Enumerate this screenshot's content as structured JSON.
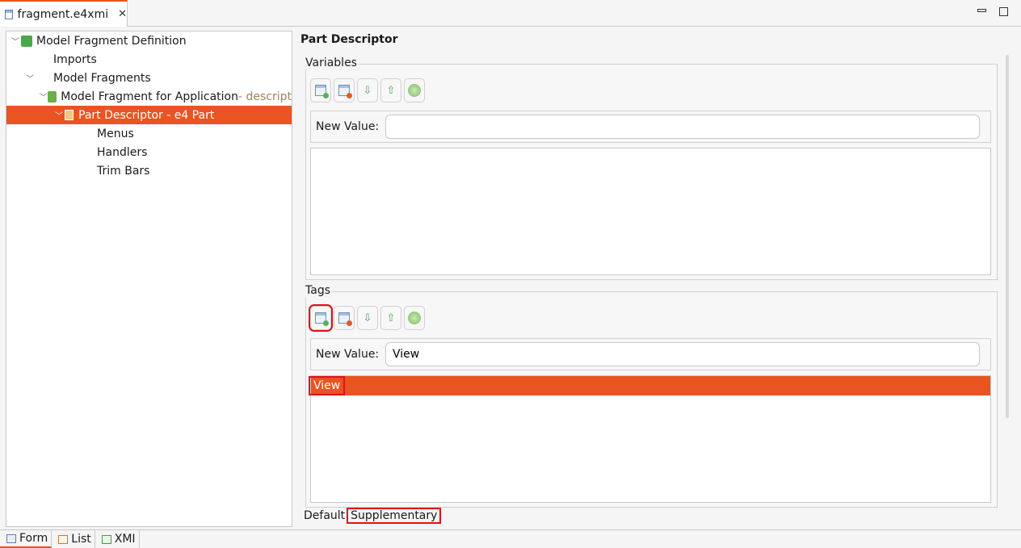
{
  "editor": {
    "tab_title": "fragment.e4xmi",
    "close_icon": "close-icon",
    "minimize_icon": "minimize-icon",
    "maximize_icon": "maximize-icon"
  },
  "tree": {
    "items": [
      {
        "label": "Model Fragment Definition",
        "suffix": "",
        "icon": "puzzle-icon",
        "expanded": true
      },
      {
        "label": "Imports",
        "suffix": ""
      },
      {
        "label": "Model Fragments",
        "suffix": "",
        "expanded": true
      },
      {
        "label": "Model Fragment for Application",
        "suffix": " - descript",
        "icon": "puzzle-edit-icon",
        "expanded": true
      },
      {
        "label": "Part Descriptor - e4 Part",
        "suffix": "",
        "icon": "part-descriptor-icon",
        "expanded": true,
        "selected": true
      },
      {
        "label": "Menus",
        "suffix": ""
      },
      {
        "label": "Handlers",
        "suffix": ""
      },
      {
        "label": "Trim Bars",
        "suffix": ""
      }
    ]
  },
  "detail": {
    "title": "Part Descriptor",
    "variables": {
      "label": "Variables",
      "new_value_label": "New Value:",
      "new_value": ""
    },
    "tags": {
      "label": "Tags",
      "new_value_label": "New Value:",
      "new_value": "View",
      "items": [
        "View"
      ]
    },
    "toolbar_icons": [
      "add-icon",
      "remove-icon",
      "move-down-icon",
      "move-up-icon",
      "edit-icon"
    ],
    "bottom_tabs": [
      "Default",
      "Supplementary"
    ],
    "active_bottom_tab": "Supplementary"
  },
  "page_tabs": [
    {
      "label": "Form",
      "icon": "form-icon",
      "active": true
    },
    {
      "label": "List",
      "icon": "list-icon"
    },
    {
      "label": "XMI",
      "icon": "xmi-tree-icon"
    }
  ],
  "colors": {
    "accent": "#e95420",
    "highlight_box": "#e0101a"
  }
}
